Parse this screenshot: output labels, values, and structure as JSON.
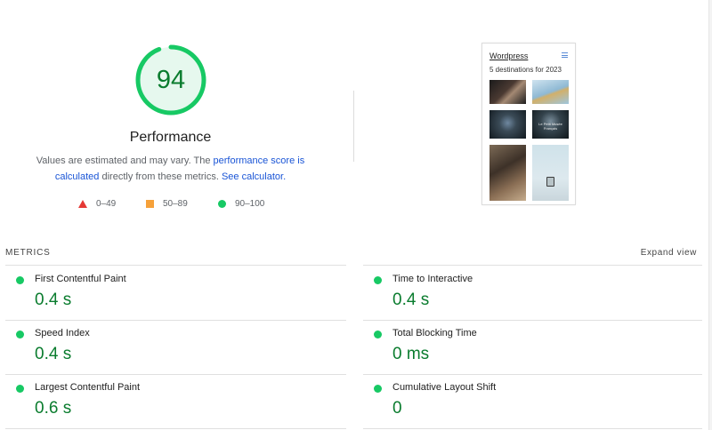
{
  "score": {
    "value": "94",
    "fraction": 0.94,
    "title": "Performance",
    "desc_prefix": "Values are estimated and may vary. The ",
    "desc_link1": "performance score is calculated",
    "desc_middle": " directly from these metrics. ",
    "desc_link2": "See calculator."
  },
  "legend": [
    {
      "range": "0–49",
      "shape": "triangle",
      "color": "#e53935"
    },
    {
      "range": "50–89",
      "shape": "square",
      "color": "#f6a13a"
    },
    {
      "range": "90–100",
      "shape": "circle",
      "color": "#17c964"
    }
  ],
  "thumbnail": {
    "title": "Wordpress",
    "subtitle": "5 destinations for 2023",
    "tile_text": "Le Petit Musée Français",
    "menu_icon": "hamburger-icon"
  },
  "metrics": {
    "header": "METRICS",
    "expand_label": "Expand view",
    "items": [
      {
        "name": "First Contentful Paint",
        "value": "0.4 s"
      },
      {
        "name": "Time to Interactive",
        "value": "0.4 s"
      },
      {
        "name": "Speed Index",
        "value": "0.4 s"
      },
      {
        "name": "Total Blocking Time",
        "value": "0 ms"
      },
      {
        "name": "Largest Contentful Paint",
        "value": "0.6 s"
      },
      {
        "name": "Cumulative Layout Shift",
        "value": "0"
      }
    ]
  },
  "colors": {
    "pass_green": "#17c964",
    "pass_text": "#0a7c2e",
    "gauge_bg": "#e6f8ee",
    "link_blue": "#1a55d6"
  }
}
